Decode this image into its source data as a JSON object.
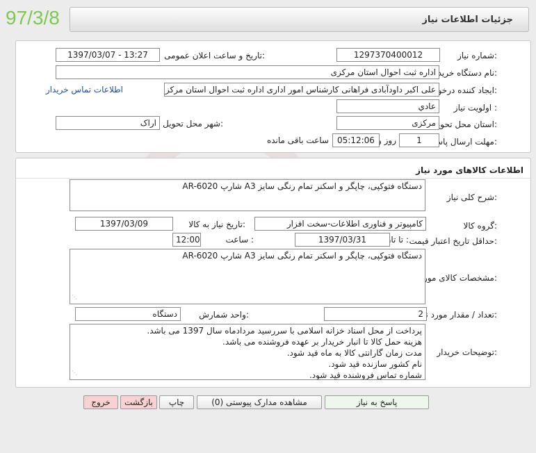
{
  "stamp": "97/3/8",
  "header": {
    "title": "جزئیات اطلاعات نیاز"
  },
  "info": {
    "need_number_label": "شماره نیاز:",
    "need_number": "1297370400012",
    "announce_label": "تاریخ و ساعت اعلان عمومی:",
    "announce_value": "1397/03/07 - 13:27",
    "buyer_label": "نام دستگاه خریدار:",
    "buyer_value": "اداره ثبت احوال استان مرکزی",
    "creator_label": "ایجاد کننده درخواست:",
    "creator_value": "علی اکبر داودآبادی فراهانی کارشناس امور اداری اداره ثبت احوال استان مرکزی",
    "contact_link": "اطلاعات تماس خریدار",
    "priority_label": "اولویت نیاز :",
    "priority_value": "عادي",
    "province_label": "استان محل تحویل:",
    "province_value": "مرکزی",
    "city_label": "شهر محل تحویل:",
    "city_value": "اراک",
    "deadline_label": "مهلت ارسال پاسخ:",
    "days_value": "1",
    "days_label": "روز و",
    "time_value": "05:12:06",
    "remaining_label": "ساعت باقی مانده"
  },
  "goods": {
    "section_title": "اطلاعات کالاهای مورد نیاز",
    "general_desc_label": "شرح کلی نیاز:",
    "general_desc": "دستگاه فتوکپی، چاپگر و اسکنر تمام رنگی سایز A3 شارپ AR-6020",
    "group_label": "گروه کالا:",
    "group_value": "کامپیوتر و فناوری اطلاعات-سخت افزار",
    "need_date_label": "تاریخ نیاز به کالا:",
    "need_date": "1397/03/09",
    "price_valid_label": "حداقل تاریخ اعتبار قیمت:",
    "to_date_label": "تا تاریخ :",
    "to_date": "1397/03/31",
    "hour_label": "ساعت :",
    "hour_value": "12:00",
    "spec_label": "مشخصات کالای مورد نیاز:",
    "spec_value": "دستگاه فتوکپی، چاپگر و اسکنر تمام رنگی سایز A3 شارپ AR-6020",
    "qty_label": "تعداد / مقدار مورد نیاز:",
    "qty_value": "2",
    "unit_label": "واحد شمارش:",
    "unit_value": "دستگاه",
    "notes_label": "توضیحات خریدار:",
    "notes_lines": [
      "پرداخت از محل اسناد خزانه اسلامی با سررسید مردادماه سال 1397 می باشد.",
      "هزینه حمل کالا تا انبار خریدار بر عهده فروشنده می باشد.",
      "مدت زمان گارانتی کالا به ماه قید شود.",
      "نام کشور سازنده قید شود.",
      "شماره تماس فروشنده قید شود."
    ]
  },
  "buttons": {
    "reply": "پاسخ به نیاز",
    "attachments": "مشاهده مدارک پیوستی (0)",
    "print": "چاپ",
    "back": "بازگشت",
    "exit": "خروج"
  }
}
